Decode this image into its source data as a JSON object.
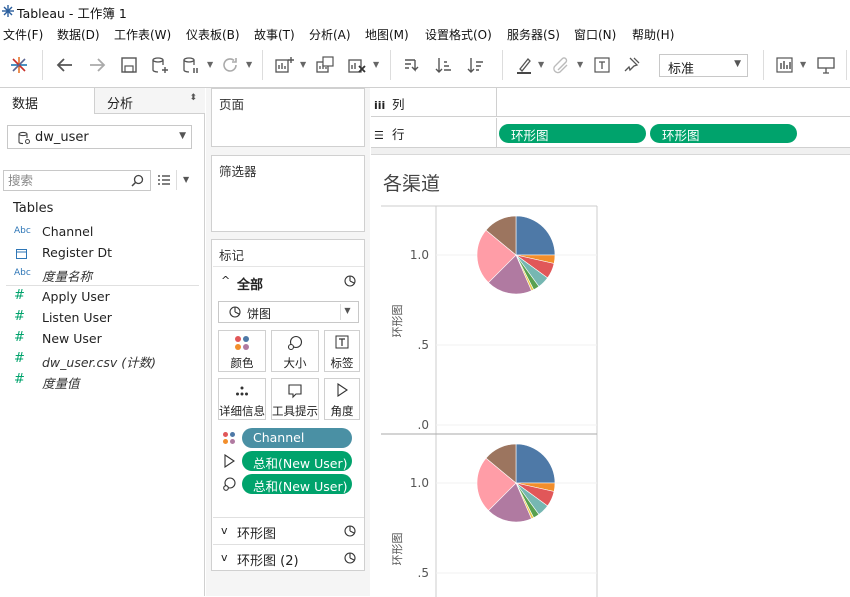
{
  "window": {
    "title": "Tableau - 工作簿 1"
  },
  "menu": [
    "文件(F)",
    "数据(D)",
    "工作表(W)",
    "仪表板(B)",
    "故事(T)",
    "分析(A)",
    "地图(M)",
    "设置格式(O)",
    "服务器(S)",
    "窗口(N)",
    "帮助(H)"
  ],
  "toolbar": {
    "icons": [
      "tableau-logo-icon",
      "undo-icon",
      "redo-icon",
      "save-icon",
      "new-datasource-icon",
      "pause-updates-icon",
      "refresh-icon",
      "new-worksheet-icon",
      "duplicate-sheet-icon",
      "clear-sheet-icon",
      "swap-rows-columns-icon",
      "sort-ascending-icon",
      "sort-descending-icon",
      "highlight-icon",
      "group-icon",
      "show-labels-icon",
      "fix-axes-icon",
      "show-me-icon",
      "presentation-icon"
    ],
    "fit_value": "标准"
  },
  "datapane": {
    "tabs": {
      "data": "数据",
      "analytics": "分析"
    },
    "datasource": "dw_user",
    "search_placeholder": "搜索",
    "tables_heading": "Tables",
    "dimensions": [
      {
        "type": "Abc",
        "name": "Channel",
        "italic": false
      },
      {
        "type": "date",
        "name": "Register Dt",
        "italic": false
      },
      {
        "type": "Abc",
        "name": "度量名称",
        "italic": true
      }
    ],
    "measures": [
      {
        "name": "Apply User",
        "italic": false
      },
      {
        "name": "Listen User",
        "italic": false
      },
      {
        "name": "New User",
        "italic": false
      },
      {
        "name": "dw_user.csv (计数)",
        "italic": true
      },
      {
        "name": "度量值",
        "italic": true
      }
    ]
  },
  "shelves": {
    "pages": "页面",
    "filters": "筛选器",
    "marks": "标记",
    "marks_all": "全部",
    "mark_type": "饼图",
    "buttons": [
      "颜色",
      "大小",
      "标签",
      "详细信息",
      "工具提示",
      "角度"
    ],
    "encodings": [
      {
        "icon": "color-encoding-icon",
        "field": "Channel",
        "color": "blue"
      },
      {
        "icon": "angle-encoding-icon",
        "field": "总和(New User)",
        "color": "green"
      },
      {
        "icon": "size-encoding-icon",
        "field": "总和(New User)",
        "color": "green"
      }
    ],
    "layers": [
      "环形图",
      "环形图 (2)"
    ],
    "columns_label": "列",
    "rows_label": "行",
    "row_pills": [
      "环形图",
      "环形图"
    ]
  },
  "view": {
    "title": "各渠道"
  },
  "chart_data": {
    "type": "pie",
    "panes": [
      {
        "axis_label": "环形图",
        "ticks": [
          "1.0",
          ".5",
          ".0"
        ]
      },
      {
        "axis_label": "环形图",
        "ticks": [
          "1.0",
          ".5"
        ]
      }
    ],
    "slices": [
      {
        "value": 25.0,
        "color": "#4e79a7"
      },
      {
        "value": 3.5,
        "color": "#f28e2b"
      },
      {
        "value": 6.5,
        "color": "#e15759"
      },
      {
        "value": 5.0,
        "color": "#76b7b2"
      },
      {
        "value": 2.5,
        "color": "#59a14f"
      },
      {
        "value": 1.0,
        "color": "#edc948"
      },
      {
        "value": 19.0,
        "color": "#b07aa1"
      },
      {
        "value": 23.5,
        "color": "#ff9da7"
      },
      {
        "value": 14.0,
        "color": "#9c755f"
      }
    ]
  }
}
